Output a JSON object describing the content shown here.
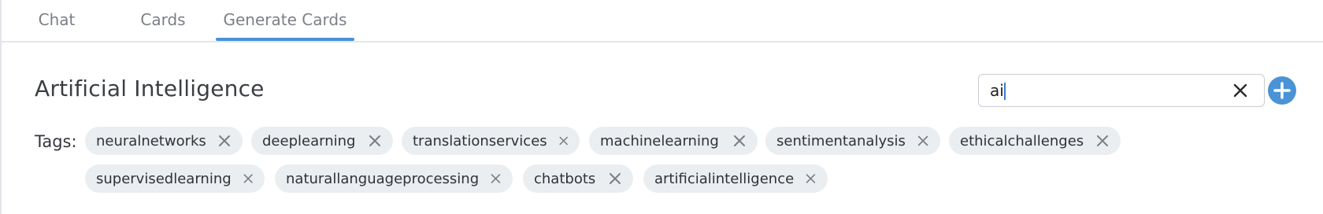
{
  "tabs": [
    {
      "label": "Chat"
    },
    {
      "label": "Cards"
    },
    {
      "label": "Generate Cards",
      "active": true
    }
  ],
  "page": {
    "title": "Artificial Intelligence"
  },
  "search": {
    "value": "ai"
  },
  "tags_label": "Tags:",
  "tags": [
    "neuralnetworks",
    "deeplearning",
    "translationservices",
    "machinelearning",
    "sentimentanalysis",
    "ethicalchallenges",
    "supervisedlearning",
    "naturallanguageprocessing",
    "chatbots",
    "artificialintelligence"
  ],
  "icons": {
    "clear": "close-icon",
    "add": "plus-icon",
    "remove_tag": "close-icon"
  },
  "colors": {
    "accent": "#4a90d9",
    "tag_background": "#eaeef1",
    "add_button": "#4a93d6"
  }
}
